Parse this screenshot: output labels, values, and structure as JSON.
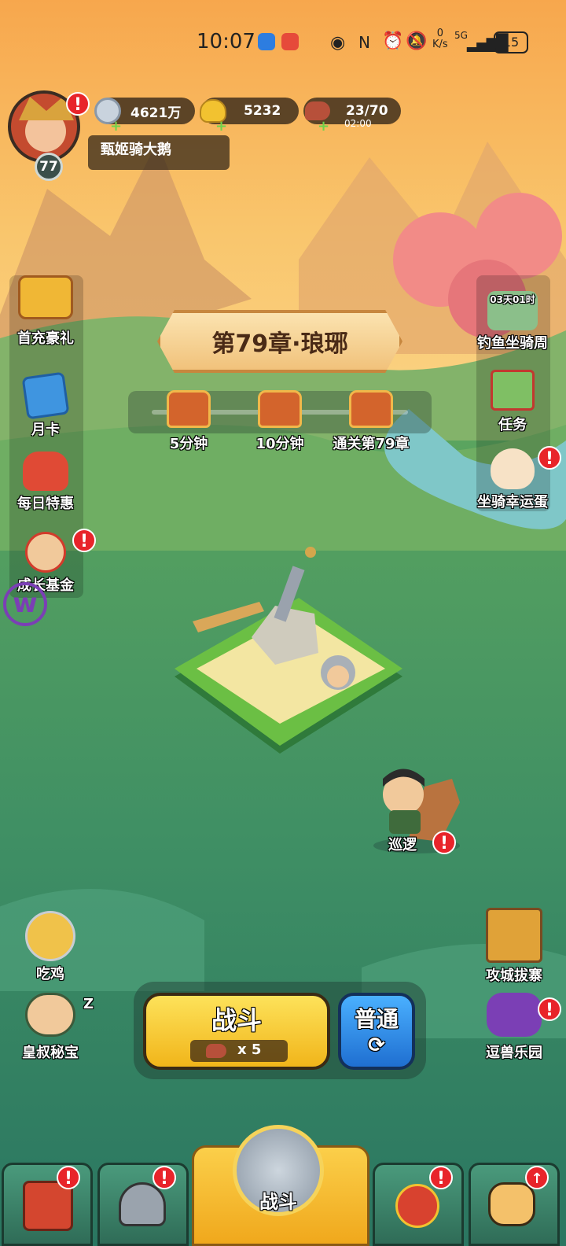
{
  "status_bar": {
    "time": "10:07",
    "net_speed_value": "0",
    "net_speed_unit": "K/s",
    "network": "5G",
    "battery": "15"
  },
  "player": {
    "level": "77",
    "name": "甄姬骑大鹅"
  },
  "currencies": {
    "silver": "4621万",
    "gold": "5232",
    "stamina": "23/70",
    "stamina_timer": "02:00"
  },
  "chapter": {
    "title": "第79章·琅琊",
    "rewards": [
      {
        "label": "5分钟"
      },
      {
        "label": "10分钟"
      },
      {
        "label": "通关第79章"
      }
    ]
  },
  "left_menu": [
    {
      "label": "首充豪礼",
      "alert": false
    },
    {
      "label": "月卡",
      "alert": false
    },
    {
      "label": "每日特惠",
      "alert": false
    },
    {
      "label": "成长基金",
      "alert": true
    }
  ],
  "right_menu": [
    {
      "label": "钓鱼坐骑周",
      "timer": "03天01时",
      "alert": false
    },
    {
      "label": "任务",
      "alert": false
    },
    {
      "label": "坐骑幸运蛋",
      "alert": true
    }
  ],
  "patrol": {
    "label": "巡逻",
    "alert": true
  },
  "lower_left": [
    {
      "label": "吃鸡"
    },
    {
      "label": "皇叔秘宝",
      "sleep": "Z"
    }
  ],
  "lower_right": [
    {
      "label": "攻城拔寨"
    },
    {
      "label": "逗兽乐园",
      "alert": true
    }
  ],
  "battle": {
    "label": "战斗",
    "cost": "x 5",
    "mode": "普通"
  },
  "bottom_nav": {
    "center_label": "战斗",
    "alert_mark": "!"
  },
  "colors": {
    "alert_red": "#e8242a",
    "battle_yellow": "#f6c51d",
    "mode_blue": "#2f8fe6",
    "grass": "#3e9a5e"
  }
}
